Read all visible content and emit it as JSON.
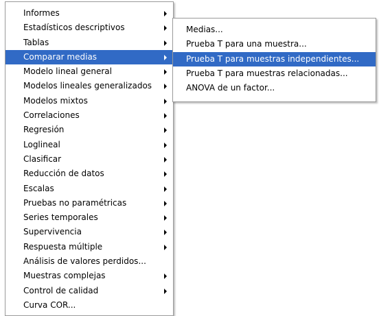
{
  "main_menu": {
    "items": [
      {
        "label": "Informes",
        "submenu": true
      },
      {
        "label": "Estadísticos descriptivos",
        "submenu": true
      },
      {
        "label": "Tablas",
        "submenu": true
      },
      {
        "label": "Comparar medias",
        "submenu": true,
        "selected": true
      },
      {
        "label": "Modelo lineal general",
        "submenu": true
      },
      {
        "label": "Modelos lineales generalizados",
        "submenu": true
      },
      {
        "label": "Modelos mixtos",
        "submenu": true
      },
      {
        "label": "Correlaciones",
        "submenu": true
      },
      {
        "label": "Regresión",
        "submenu": true
      },
      {
        "label": "Loglineal",
        "submenu": true
      },
      {
        "label": "Clasificar",
        "submenu": true
      },
      {
        "label": "Reducción de datos",
        "submenu": true
      },
      {
        "label": "Escalas",
        "submenu": true
      },
      {
        "label": "Pruebas no paramétricas",
        "submenu": true
      },
      {
        "label": "Series temporales",
        "submenu": true
      },
      {
        "label": "Supervivencia",
        "submenu": true
      },
      {
        "label": "Respuesta múltiple",
        "submenu": true
      },
      {
        "label": "Análisis de valores perdidos...",
        "submenu": false
      },
      {
        "label": "Muestras complejas",
        "submenu": true
      },
      {
        "label": "Control de calidad",
        "submenu": true
      },
      {
        "label": "Curva COR...",
        "submenu": false
      }
    ]
  },
  "sub_menu": {
    "items": [
      {
        "label": "Medias...",
        "selected": false
      },
      {
        "label": "Prueba T para una muestra...",
        "selected": false
      },
      {
        "label": "Prueba T para muestras independientes...",
        "selected": true
      },
      {
        "label": "Prueba T para muestras relacionadas...",
        "selected": false
      },
      {
        "label": "ANOVA de un factor...",
        "selected": false
      }
    ]
  },
  "colors": {
    "selection": "#316ac5",
    "menu_background": "#ffffff",
    "border": "#9a9a9a"
  },
  "icons": {
    "submenu_indicator": "submenu-arrow-icon"
  }
}
